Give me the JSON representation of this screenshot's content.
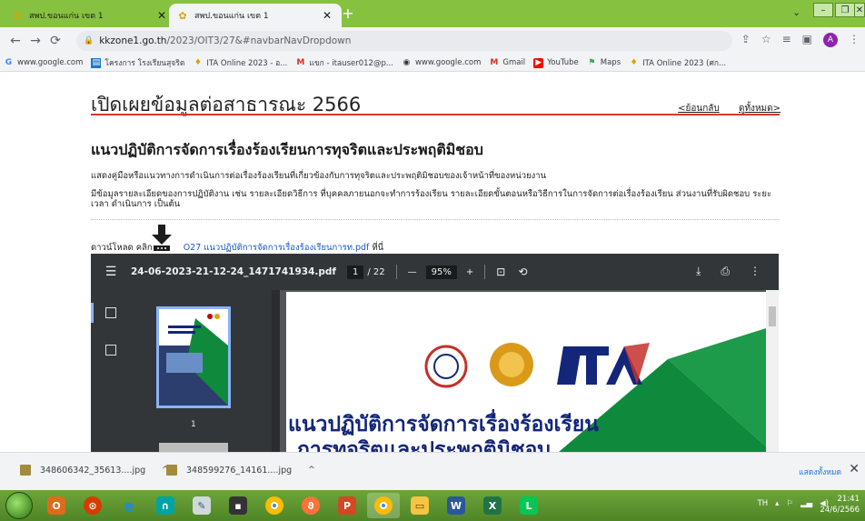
{
  "browser": {
    "tabs": [
      {
        "title": "สพป.ขอนแก่น เขต 1",
        "active": false
      },
      {
        "title": "สพป.ขอนแก่น เขต 1",
        "active": true
      }
    ],
    "new_tab_icon": "plus-icon",
    "url_host": "kkzone1.go.th",
    "url_path": "/2023/OIT3/27&#navbarNavDropdown",
    "profile_initial": "A",
    "bookmarks": [
      {
        "label": "www.google.com",
        "icon": "google-icon"
      },
      {
        "label": "โครงการ โรงเรียนสุจริต",
        "icon": "calendar-icon"
      },
      {
        "label": "ITA Online 2023 - อ...",
        "icon": "ita-icon"
      },
      {
        "label": "แขก - itauser012@p...",
        "icon": "gmail-icon"
      },
      {
        "label": "www.google.com",
        "icon": "globe-icon"
      },
      {
        "label": "Gmail",
        "icon": "gmail-icon"
      },
      {
        "label": "YouTube",
        "icon": "youtube-icon"
      },
      {
        "label": "Maps",
        "icon": "maps-icon"
      },
      {
        "label": "ITA Online 2023 (ศก...",
        "icon": "ita-icon"
      }
    ]
  },
  "page": {
    "title": "เปิดเผยข้อมูลต่อสาธารณะ 2566",
    "back_link": "<ย้อนกลับ",
    "all_link": "ดูทั้งหมด>",
    "section_title": "แนวปฏิบัติการจัดการเรื่องร้องเรียนการทุจริตและประพฤติมิชอบ",
    "desc1": "แสดงคู่มือหรือแนวทางการดำเนินการต่อเรื่องร้องเรียนที่เกี่ยวข้องกับการทุจริตและประพฤติมิชอบของเจ้าหน้าที่ของหน่วยงาน",
    "desc2": "มีข้อมูลรายละเอียดของการปฏิบัติงาน เช่น รายละเอียดวิธีการ ที่บุคคลภายนอกจะทำการร้องเรียน รายละเอียดขั้นตอนหรือวิธีการในการจัดการต่อเรื่องร้องเรียน ส่วนงานที่รับผิดชอบ ระยะเวลา ดำเนินการ เป็นต้น",
    "download_prefix": "ดาวน์โหลด คลิก",
    "download_link": "O27 แนวปฏิบัติการจัดการเรื่องร้องเรียนการท.pdf",
    "download_suffix": "ที่นี่"
  },
  "pdf": {
    "filename": "24-06-2023-21-12-24_1471741934.pdf",
    "current_page": "1",
    "total_pages": "/ 22",
    "zoom": "95%",
    "thumb_page_number": "1",
    "doc_logo_text": "ITA",
    "doc_heading_line1": "แนวปฏิบัติการจัดการเรื่องร้องเรียน",
    "doc_heading_line2": "การทุจริตและประพฤติมิชอบ"
  },
  "downloads": [
    {
      "name": "348606342_35613....jpg"
    },
    {
      "name": "348599276_14161....jpg"
    }
  ],
  "shelf_show_all": "แสดงทั้งหมด",
  "taskbar": {
    "lang": "TH",
    "time": "21:41",
    "date": "24/6/2566"
  },
  "colors": {
    "tab_strip": "#86c240",
    "title_rule": "#d73a2a",
    "pdf_toolbar": "#323639",
    "doc_heading": "#14267a",
    "doc_green": "#0f8a3c",
    "link": "#1a56c9"
  }
}
